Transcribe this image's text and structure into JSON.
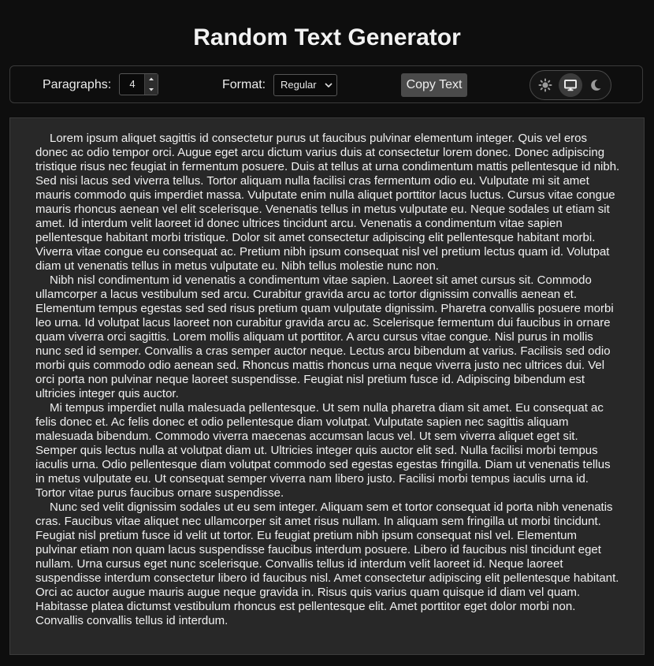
{
  "app": {
    "title": "Random Text Generator"
  },
  "controls": {
    "paragraphs_label": "Paragraphs:",
    "paragraphs_value": "4",
    "format_label": "Format:",
    "format_value": "Regular",
    "copy_label": "Copy Text",
    "theme": {
      "options": [
        "light",
        "system",
        "dark"
      ],
      "selected": "system",
      "icons": [
        "sun-icon",
        "monitor-icon",
        "moon-icon"
      ]
    }
  },
  "content": {
    "paragraphs": [
      "Lorem ipsum aliquet sagittis id consectetur purus ut faucibus pulvinar elementum integer. Quis vel eros donec ac odio tempor orci. Augue eget arcu dictum varius duis at consectetur lorem donec. Donec adipiscing tristique risus nec feugiat in fermentum posuere. Duis at tellus at urna condimentum mattis pellentesque id nibh. Sed nisi lacus sed viverra tellus. Tortor aliquam nulla facilisi cras fermentum odio eu. Vulputate mi sit amet mauris commodo quis imperdiet massa. Vulputate enim nulla aliquet porttitor lacus luctus. Cursus vitae congue mauris rhoncus aenean vel elit scelerisque. Venenatis tellus in metus vulputate eu. Neque sodales ut etiam sit amet. Id interdum velit laoreet id donec ultrices tincidunt arcu. Venenatis a condimentum vitae sapien pellentesque habitant morbi tristique. Dolor sit amet consectetur adipiscing elit pellentesque habitant morbi. Viverra vitae congue eu consequat ac. Pretium nibh ipsum consequat nisl vel pretium lectus quam id. Volutpat diam ut venenatis tellus in metus vulputate eu. Nibh tellus molestie nunc non.",
      "Nibh nisl condimentum id venenatis a condimentum vitae sapien. Laoreet sit amet cursus sit. Commodo ullamcorper a lacus vestibulum sed arcu. Curabitur gravida arcu ac tortor dignissim convallis aenean et. Elementum tempus egestas sed sed risus pretium quam vulputate dignissim. Pharetra convallis posuere morbi leo urna. Id volutpat lacus laoreet non curabitur gravida arcu ac. Scelerisque fermentum dui faucibus in ornare quam viverra orci sagittis. Lorem mollis aliquam ut porttitor. A arcu cursus vitae congue. Nisl purus in mollis nunc sed id semper. Convallis a cras semper auctor neque. Lectus arcu bibendum at varius. Facilisis sed odio morbi quis commodo odio aenean sed. Rhoncus mattis rhoncus urna neque viverra justo nec ultrices dui. Vel orci porta non pulvinar neque laoreet suspendisse. Feugiat nisl pretium fusce id. Adipiscing bibendum est ultricies integer quis auctor.",
      "Mi tempus imperdiet nulla malesuada pellentesque. Ut sem nulla pharetra diam sit amet. Eu consequat ac felis donec et. Ac felis donec et odio pellentesque diam volutpat. Vulputate sapien nec sagittis aliquam malesuada bibendum. Commodo viverra maecenas accumsan lacus vel. Ut sem viverra aliquet eget sit. Semper quis lectus nulla at volutpat diam ut. Ultricies integer quis auctor elit sed. Nulla facilisi morbi tempus iaculis urna. Odio pellentesque diam volutpat commodo sed egestas egestas fringilla. Diam ut venenatis tellus in metus vulputate eu. Ut consequat semper viverra nam libero justo. Facilisi morbi tempus iaculis urna id. Tortor vitae purus faucibus ornare suspendisse.",
      "Nunc sed velit dignissim sodales ut eu sem integer. Aliquam sem et tortor consequat id porta nibh venenatis cras. Faucibus vitae aliquet nec ullamcorper sit amet risus nullam. In aliquam sem fringilla ut morbi tincidunt. Feugiat nisl pretium fusce id velit ut tortor. Eu feugiat pretium nibh ipsum consequat nisl vel. Elementum pulvinar etiam non quam lacus suspendisse faucibus interdum posuere. Libero id faucibus nisl tincidunt eget nullam. Urna cursus eget nunc scelerisque. Convallis tellus id interdum velit laoreet id. Neque laoreet suspendisse interdum consectetur libero id faucibus nisl. Amet consectetur adipiscing elit pellentesque habitant. Orci ac auctor augue mauris augue neque gravida in. Risus quis varius quam quisque id diam vel quam. Habitasse platea dictumst vestibulum rhoncus est pellentesque elit. Amet porttitor eget dolor morbi non. Convallis convallis tellus id interdum."
    ]
  },
  "colors": {
    "page_background": "#0e0e0e",
    "text_area_background": "#282828",
    "copy_button_background": "#4a4a4a",
    "text": "#f0f0f0"
  }
}
